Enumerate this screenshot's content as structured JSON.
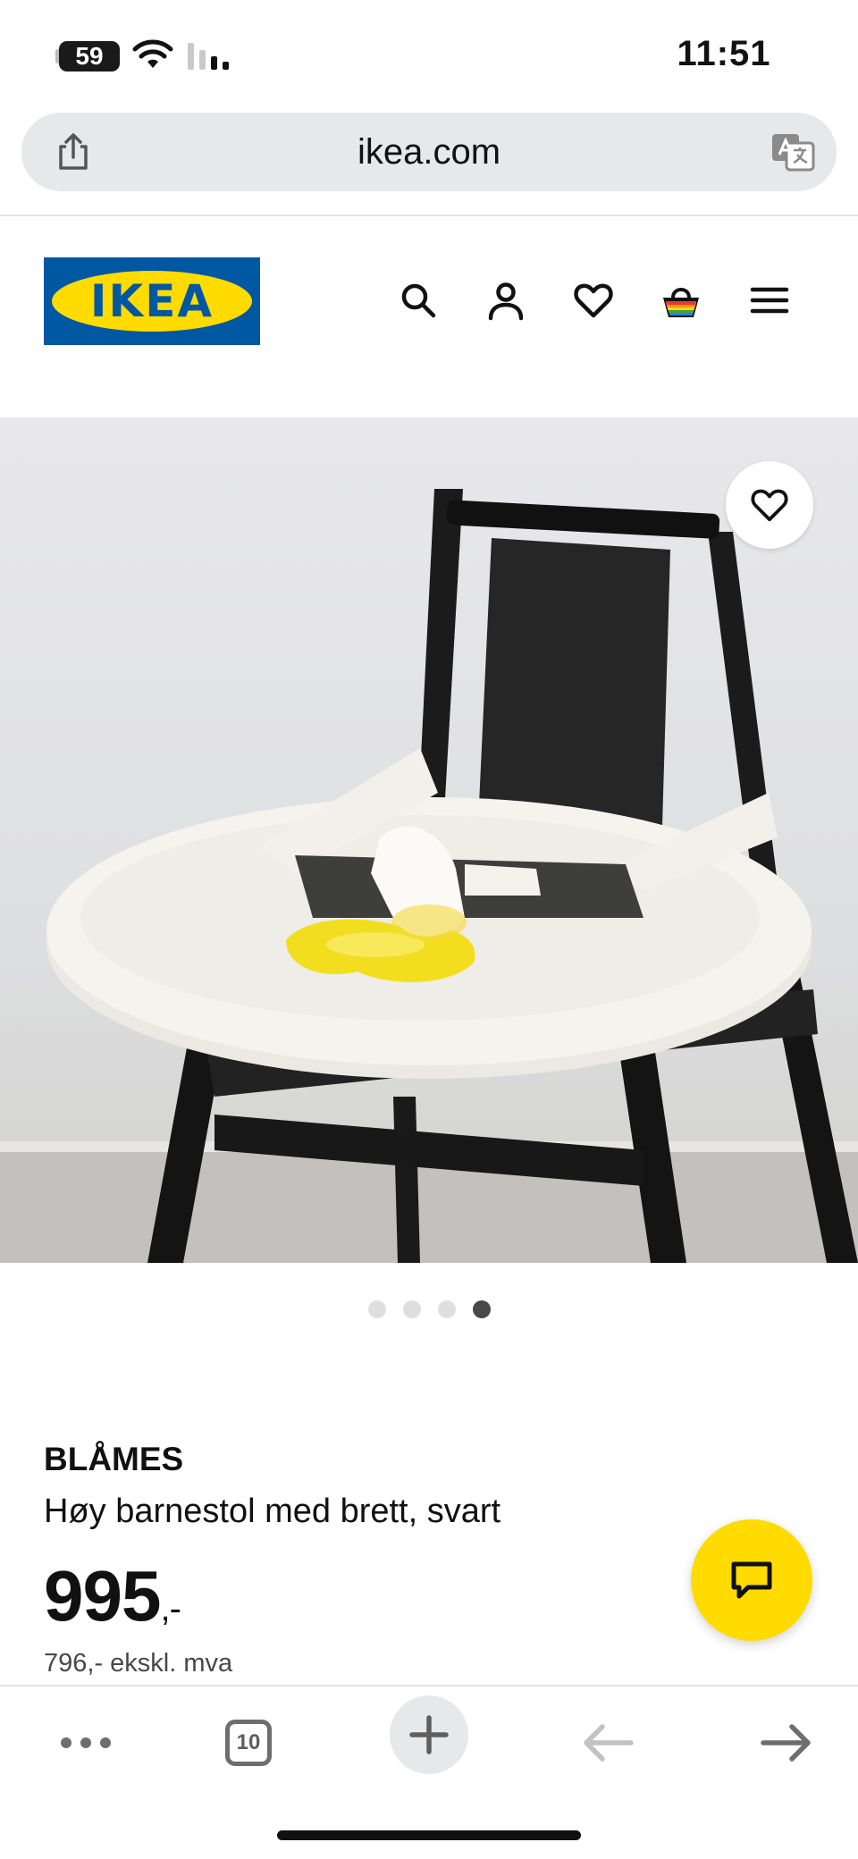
{
  "status_bar": {
    "battery": "59",
    "time": "11:51"
  },
  "browser": {
    "url": "ikea.com"
  },
  "header": {
    "logo_text": "IKEA",
    "brand_colors": {
      "blue": "#0058a3",
      "yellow": "#ffdb00"
    },
    "icons": [
      "search-icon",
      "profile-icon",
      "heart-icon",
      "basket-icon",
      "menu-icon"
    ]
  },
  "gallery": {
    "slide_count": 4,
    "active_slide": 4
  },
  "product": {
    "name": "BLÅMES",
    "description": "Høy barnestol med brett, svart",
    "price": "995",
    "price_suffix": ",-",
    "price_ex_vat": "796,- ekskl. mva"
  },
  "toolbar": {
    "tabs_count": "10"
  }
}
